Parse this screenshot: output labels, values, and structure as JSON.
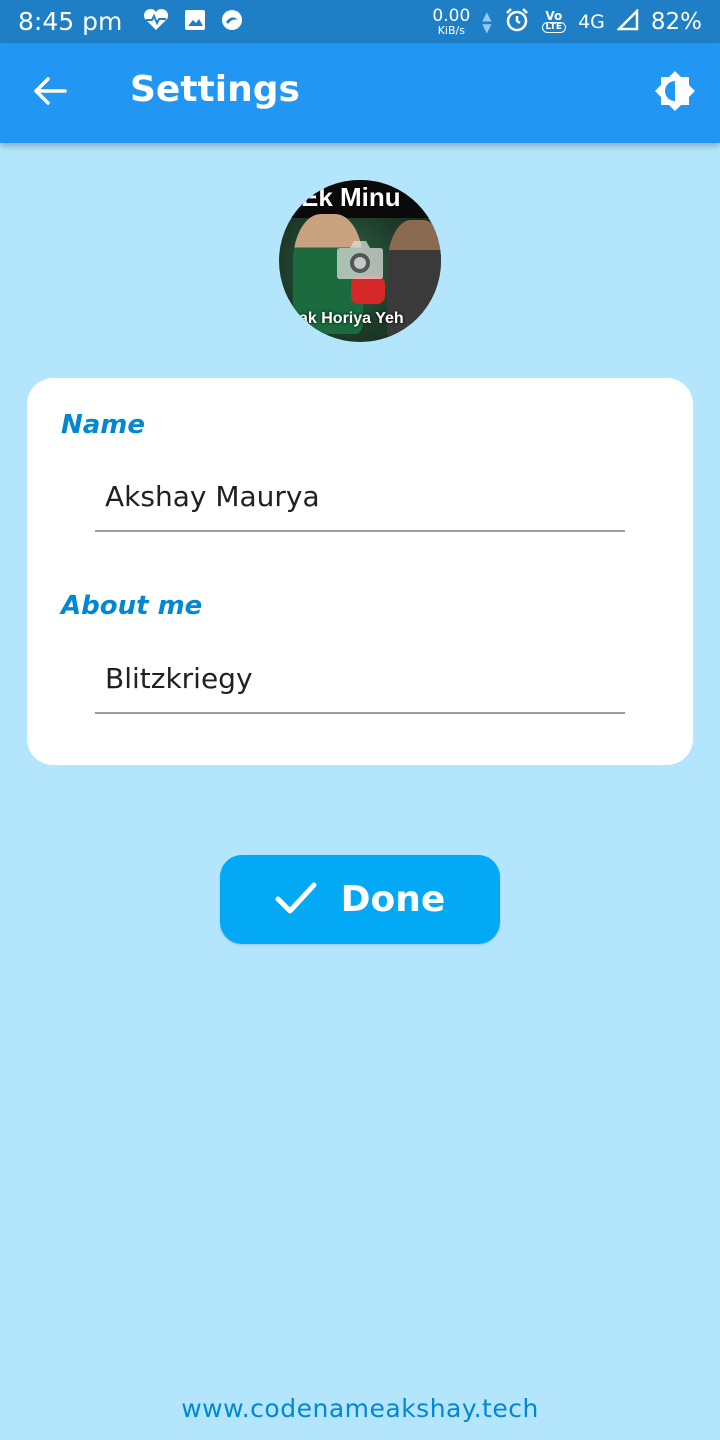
{
  "status_bar": {
    "time": "8:45 pm",
    "net_speed_value": "0.00",
    "net_speed_unit": "KiB/s",
    "volte_top": "Vo",
    "volte_bottom": "LTE",
    "network": "4G",
    "battery": "82%",
    "left_icons": [
      "heart-pulse-icon",
      "image-icon",
      "swirl-app-icon"
    ],
    "right_icons": [
      "alarm-icon",
      "signal-icon"
    ]
  },
  "app_bar": {
    "title": "Settings",
    "back_icon": "arrow-left-icon",
    "theme_icon": "brightness-icon",
    "color": "#2196f3"
  },
  "avatar": {
    "overlay_top_text": "Ek Minu",
    "overlay_bottom_text": "zak Horiya Yeh",
    "camera_icon": "camera-icon"
  },
  "form": {
    "name_label": "Name",
    "name_value": "Akshay Maurya",
    "about_label": "About me",
    "about_value": "Blitzkriegy",
    "accent_color": "#0288d1"
  },
  "done_button": {
    "label": "Done",
    "icon": "check-icon",
    "color": "#03a9f4"
  },
  "footer": {
    "link_text": "www.codenameakshay.tech"
  },
  "background_color": "#b3e5fc"
}
